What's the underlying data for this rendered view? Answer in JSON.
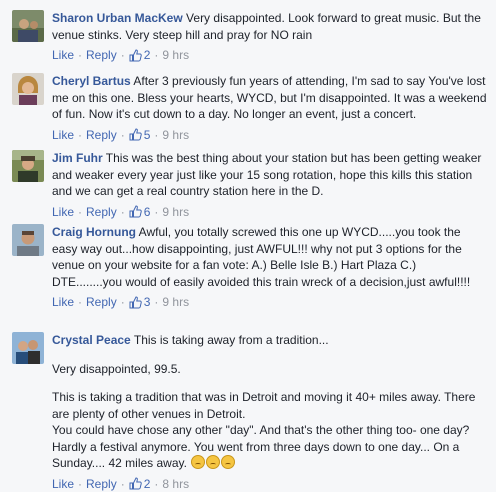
{
  "actions": {
    "like": "Like",
    "reply": "Reply",
    "dot": "·"
  },
  "comments": [
    {
      "author": "Sharon Urban MacKew",
      "text": "Very disappointed. Look forward to great music. But the venue stinks. Very steep hill and pray for NO rain",
      "likes": "2",
      "time": "9 hrs",
      "avatar": "avatar-photo-sharon"
    },
    {
      "author": "Cheryl Bartus",
      "text": "After 3 previously fun years of attending, I'm sad to say You've lost me on this one. Bless your hearts, WYCD, but I'm disappointed. It was a weekend of fun. Now it's cut down to a day. No longer an event, just a concert.",
      "likes": "5",
      "time": "9 hrs",
      "avatar": "avatar-photo-cheryl"
    },
    {
      "author": "Jim Fuhr",
      "text": "This was the best thing about your station but has been getting weaker and weaker every year just like your 15 song rotation, hope this kills this station and we can get a real country station here in the D.",
      "likes": "6",
      "time": "9 hrs",
      "avatar": "avatar-photo-jim"
    },
    {
      "author": "Craig Hornung",
      "text": "Awful, you totally screwed this one up WYCD.....you took the easy way out...how disappointing, just AWFUL!!! why not put 3 options for the venue on your website for a fan vote: A.) Belle Isle B.) Hart Plaza C.) DTE........you would of easily avoided this train wreck of a decision,just awful!!!!",
      "likes": "3",
      "time": "9 hrs",
      "avatar": "avatar-photo-craig"
    },
    {
      "author": "Crystal Peace",
      "text": "This is taking away from a tradition...",
      "paragraphs": [
        "Very disappointed, 99.5.",
        "This is taking a tradition that was in Detroit and moving it 40+ miles away. There are plenty of other venues in Detroit.\nYou could have chose any other \"day\". And that's the other thing too- one day? Hardly a festival anymore. You went from three days down to one day... On a Sunday.... 42 miles away."
      ],
      "emoji": [
        "sad-face-emoji",
        "crying-face-emoji",
        "sobbing-face-emoji"
      ],
      "likes": "2",
      "time": "8 hrs",
      "avatar": "avatar-photo-crystal"
    }
  ],
  "colors": {
    "name": "#365899",
    "link": "#4267b2",
    "meta": "#90949c",
    "text": "#1d2129",
    "background": "#f6f7f9"
  }
}
